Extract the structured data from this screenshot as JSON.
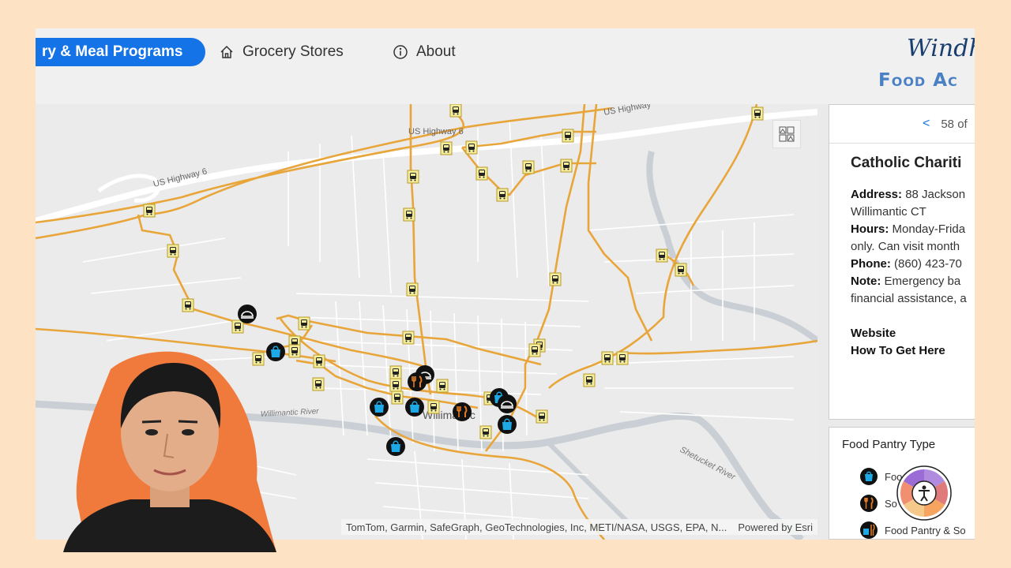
{
  "nav": {
    "tabs": [
      {
        "label": "ry & Meal Programs",
        "active": true
      },
      {
        "label": "Grocery Stores",
        "icon": "home-icon"
      },
      {
        "label": "About",
        "icon": "info-icon"
      }
    ]
  },
  "brand": {
    "line1": "Windh",
    "line2": "Food Ac"
  },
  "map": {
    "road_labels": [
      "US Highway 6",
      "US Highway 6",
      "US Highway"
    ],
    "place_labels": [
      "Willimantic",
      "Willimantic River",
      "Shetucket River"
    ],
    "attribution": "TomTom, Garmin, SafeGraph, GeoTechnologies, Inc, METI/NASA, USGS, EPA, N...",
    "powered_by": "Powered by Esri",
    "colors": {
      "road": "#e8a53a",
      "bus_stop": "#f3ec9a",
      "pantry": "#1ca9e6",
      "soup": "#e07b24"
    }
  },
  "panel": {
    "pager": {
      "prev": "<",
      "count": "58 of"
    },
    "title": "Catholic Chariti",
    "address_label": "Address:",
    "address_value": " 88 Jackson",
    "address_line2": "Willimantic CT",
    "hours_label": "Hours:",
    "hours_value": " Monday-Frida",
    "hours_line2": "only. Can visit month",
    "phone_label": "Phone:",
    "phone_value": " (860) 423-70",
    "note_label": "Note:",
    "note_value": " Emergency ba",
    "note_line2": "financial assistance, a",
    "website": "Website",
    "directions": "How To Get Here"
  },
  "legend": {
    "title": "Food Pantry Type",
    "items": [
      "Foo",
      "So",
      "Food Pantry & So"
    ]
  }
}
